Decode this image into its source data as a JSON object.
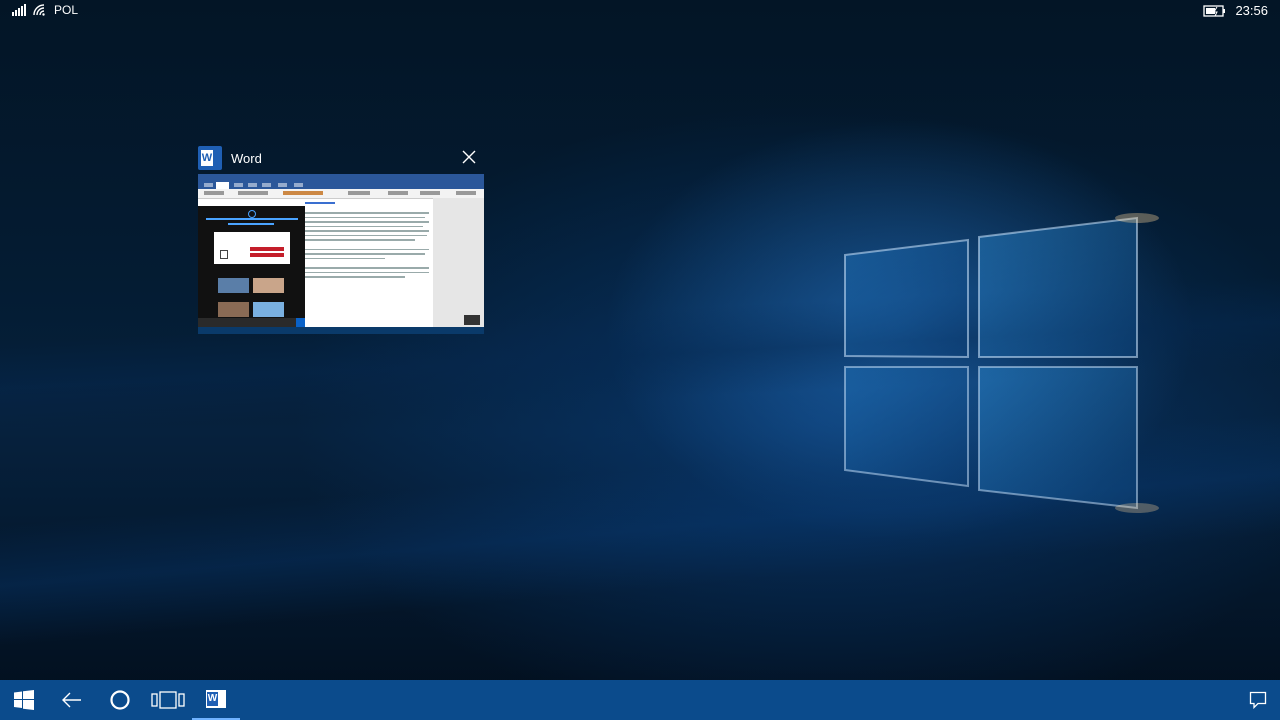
{
  "status_bar": {
    "network_label": "POL",
    "time": "23:56",
    "icons": [
      "signal-strength-icon",
      "wifi-icon",
      "battery-charging-icon"
    ]
  },
  "task_view": {
    "app_name": "Word",
    "app_icon": "word-icon",
    "close_icon": "close-icon"
  },
  "taskbar": {
    "buttons": [
      "start-icon",
      "back-icon",
      "cortana-icon",
      "task-view-icon",
      "word-icon"
    ],
    "notification_icon": "action-center-icon",
    "color": "#0b4b8c"
  },
  "colors": {
    "accent": "#2b579a",
    "taskbar": "#0b4b8c"
  }
}
